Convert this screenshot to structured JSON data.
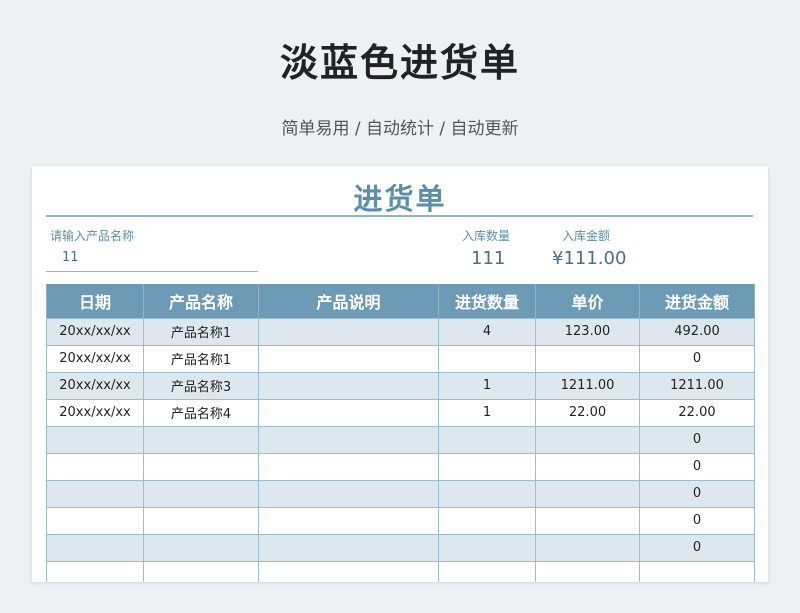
{
  "page": {
    "title": "淡蓝色进货单",
    "subtitle": "简单易用 / 自动统计 / 自动更新"
  },
  "sheet": {
    "title": "进货单",
    "search_label": "请输入产品名称",
    "search_value": "11",
    "qty_label": "入库数量",
    "qty_value": "111",
    "amount_label": "入库金额",
    "amount_value": "¥111.00"
  },
  "table": {
    "headers": [
      "日期",
      "产品名称",
      "产品说明",
      "进货数量",
      "单价",
      "进货金额"
    ],
    "rows": [
      [
        "20xx/xx/xx",
        "产品名称1",
        "",
        "4",
        "123.00",
        "492.00"
      ],
      [
        "20xx/xx/xx",
        "产品名称1",
        "",
        "",
        "",
        "0"
      ],
      [
        "20xx/xx/xx",
        "产品名称3",
        "",
        "1",
        "1211.00",
        "1211.00"
      ],
      [
        "20xx/xx/xx",
        "产品名称4",
        "",
        "1",
        "22.00",
        "22.00"
      ],
      [
        "",
        "",
        "",
        "",
        "",
        "0"
      ],
      [
        "",
        "",
        "",
        "",
        "",
        "0"
      ],
      [
        "",
        "",
        "",
        "",
        "",
        "0"
      ],
      [
        "",
        "",
        "",
        "",
        "",
        "0"
      ],
      [
        "",
        "",
        "",
        "",
        "",
        "0"
      ],
      [
        "",
        "",
        "",
        "",
        "",
        ""
      ]
    ]
  },
  "colors": {
    "header_bg": "#6d9bb5",
    "accent": "#5b8eab",
    "stripe": "#dde8ee"
  }
}
